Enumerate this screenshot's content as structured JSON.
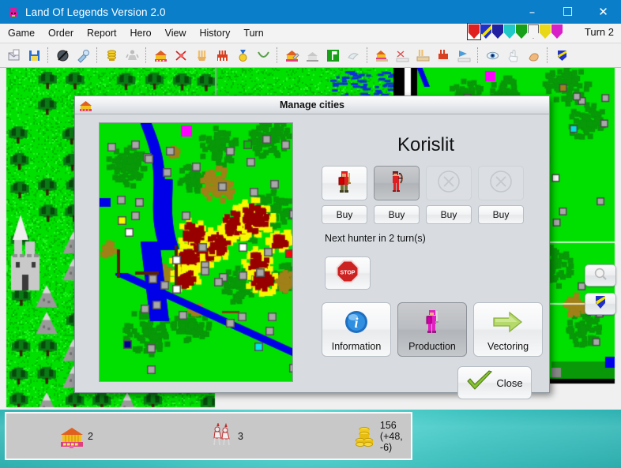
{
  "window": {
    "title": "Land Of Legends Version 2.0",
    "icon": "app-icon",
    "controls": {
      "minimize": "–",
      "maximize": "☐",
      "close": "✕"
    }
  },
  "menu": {
    "items": [
      "Game",
      "Order",
      "Report",
      "Hero",
      "View",
      "History",
      "Turn"
    ],
    "turn_label": "Turn 2",
    "shields": [
      {
        "name": "shield-player-red",
        "color": "#e02020",
        "selected": true
      },
      {
        "name": "shield-player-blue",
        "color": "#2030c8",
        "selected": false
      },
      {
        "name": "shield-player-navy",
        "color": "#2020a0",
        "selected": false
      },
      {
        "name": "shield-player-cyan",
        "color": "#20c8c8",
        "selected": false
      },
      {
        "name": "shield-player-green",
        "color": "#18a018",
        "selected": false
      },
      {
        "name": "shield-player-white",
        "color": "#f4f4f4",
        "selected": false
      },
      {
        "name": "shield-player-yellow",
        "color": "#e8d818",
        "selected": false
      },
      {
        "name": "shield-player-magenta",
        "color": "#d820c8",
        "selected": false
      }
    ]
  },
  "toolbar": {
    "groups": [
      [
        "open-icon",
        "save-icon"
      ],
      [
        "no-magic-icon",
        "magic-icon"
      ],
      [
        "gold-icon",
        "unit-grey-icon"
      ],
      [
        "city-icon",
        "battle-icon",
        "hands-icon",
        "factory-icon",
        "medal-icon",
        "necklace-icon"
      ],
      [
        "city-build-icon",
        "city-upgrade-icon",
        "flag-icon"
      ],
      [
        "city-road-icon",
        "city-hero-icon",
        "city-tower-icon",
        "city-factory-icon",
        "city-vector-icon"
      ],
      [
        "eye-icon",
        "hand-icon",
        "arm-icon"
      ],
      [
        "shield-icon"
      ]
    ]
  },
  "side_buttons": [
    {
      "name": "magnifier-button",
      "icon": "magnifier-icon"
    },
    {
      "name": "shield-button",
      "icon": "shield-blue-icon"
    }
  ],
  "dialog": {
    "title": "Manage cities",
    "title_icon": "city-icon",
    "city_name": "Korislit",
    "unit_slots": [
      {
        "name": "unit-slot-swordsman",
        "icon": "swordsman-icon",
        "state": "available",
        "selected": false
      },
      {
        "name": "unit-slot-hunter",
        "icon": "archer-icon",
        "state": "available",
        "selected": true
      },
      {
        "name": "unit-slot-empty-3",
        "icon": "disabled-x-icon",
        "state": "empty",
        "selected": false
      },
      {
        "name": "unit-slot-empty-4",
        "icon": "disabled-x-icon",
        "state": "empty",
        "selected": false
      }
    ],
    "buy_buttons": [
      "Buy",
      "Buy",
      "Buy",
      "Buy"
    ],
    "next_unit_text": "Next hunter in 2 turn(s)",
    "stop_button": {
      "name": "stop-production-button",
      "icon": "stop-sign-icon",
      "label": "STOP"
    },
    "tabs": [
      {
        "label": "Information",
        "icon": "info-icon",
        "selected": false
      },
      {
        "label": "Production",
        "icon": "production-unit-icon",
        "selected": true
      },
      {
        "label": "Vectoring",
        "icon": "arrow-right-icon",
        "selected": false
      }
    ],
    "close_button": {
      "label": "Close",
      "icon": "checkmark-icon"
    }
  },
  "statusbar": {
    "cities": {
      "icon": "city-icon",
      "value": "2"
    },
    "units": {
      "icon": "units-icon",
      "value": "3"
    },
    "gold": {
      "icon": "gold-icon",
      "value": "156 (+48, -6)"
    }
  },
  "colors": {
    "titlebar": "#0b7ec9",
    "desktop": "#17b2b2",
    "dialog_bg": "#d8dce1",
    "map_grass": "#00e000",
    "map_forest": "#089808",
    "map_water": "#0000e8",
    "map_mountain": "#a8a8a8",
    "map_lava": "#980000",
    "map_sand": "#f8f800"
  }
}
